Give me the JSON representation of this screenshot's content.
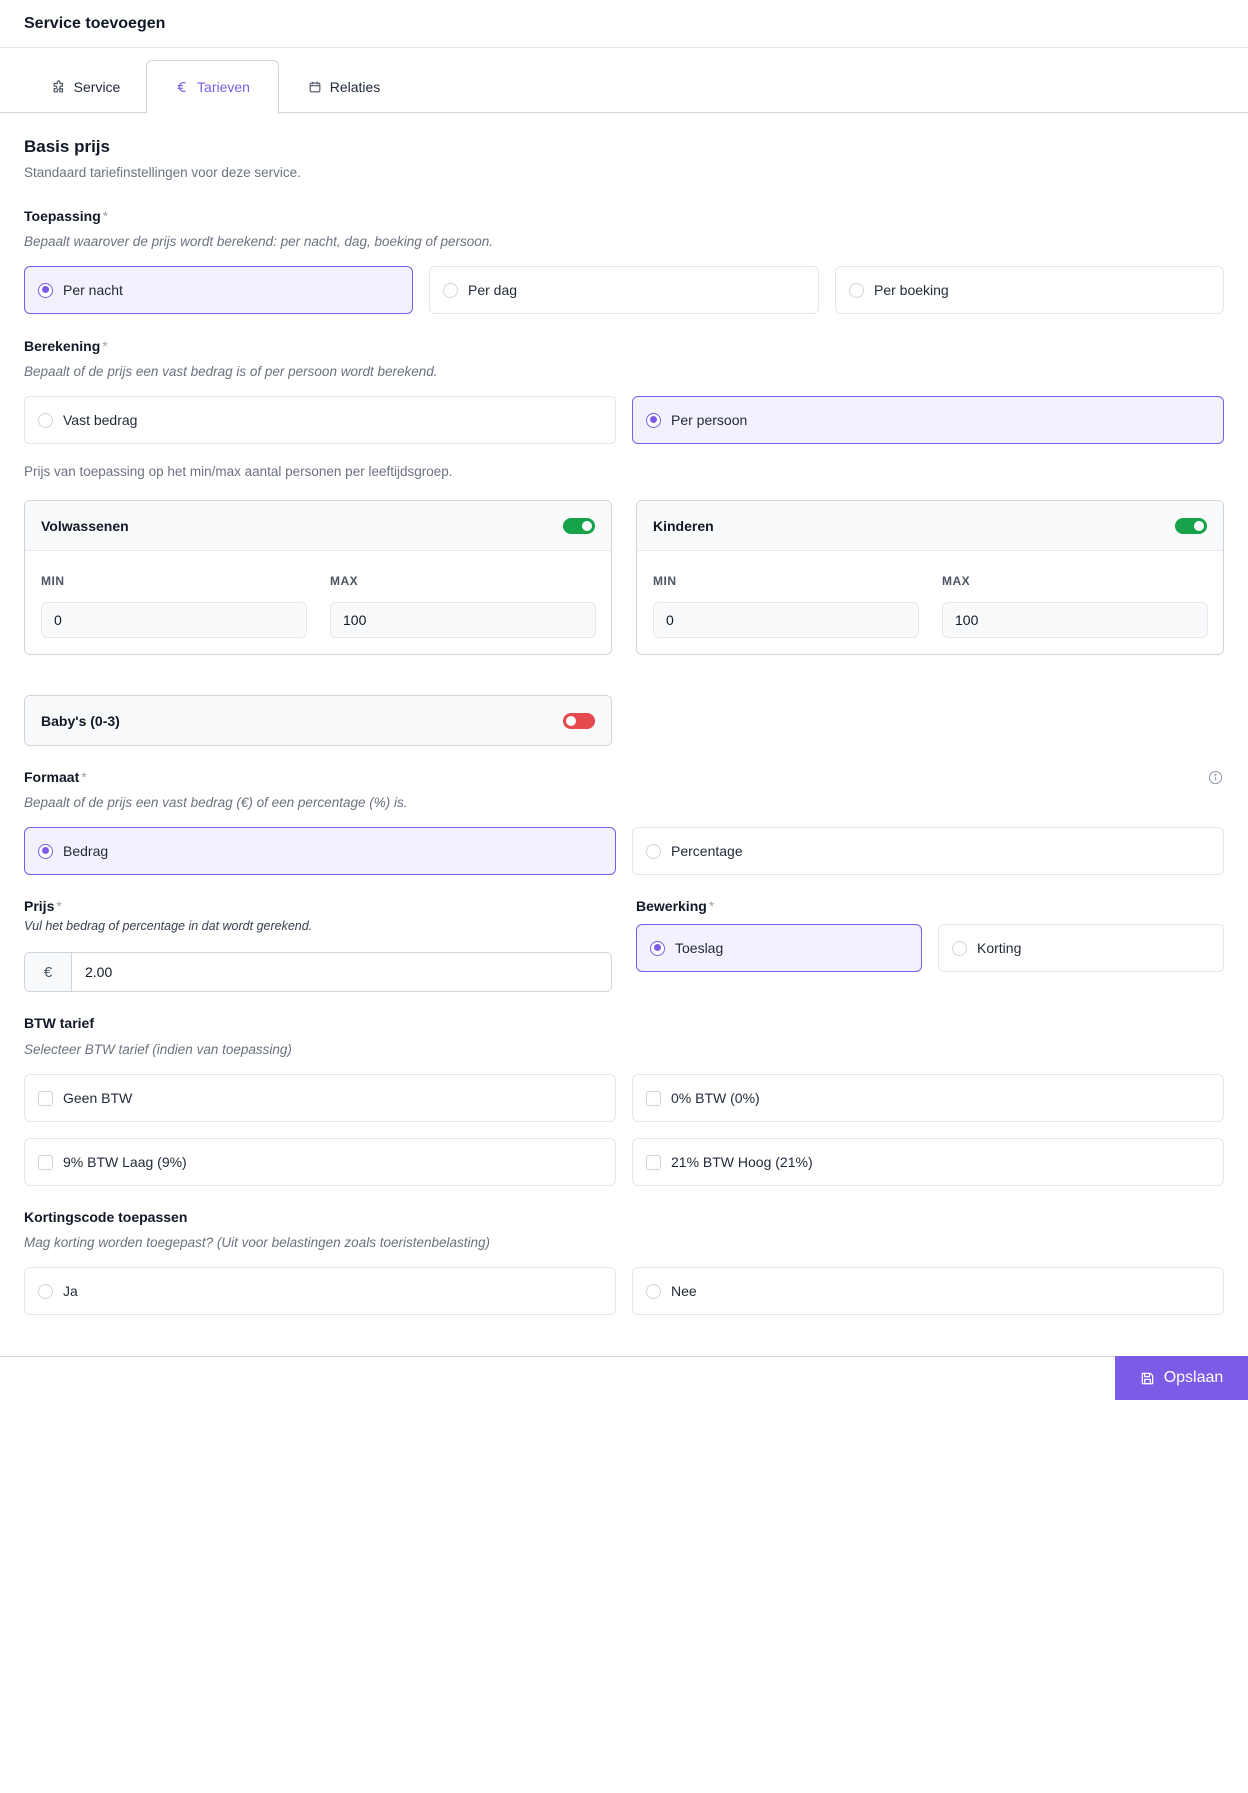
{
  "header": {
    "title": "Service toevoegen"
  },
  "tabs": [
    {
      "label": "Service",
      "icon": "puzzle-icon",
      "active": false
    },
    {
      "label": "Tarieven",
      "icon": "euro-icon",
      "active": true
    },
    {
      "label": "Relaties",
      "icon": "calendar-icon",
      "active": false
    }
  ],
  "section": {
    "title": "Basis prijs",
    "subtitle": "Standaard tariefinstellingen voor deze service."
  },
  "toepassing": {
    "label": "Toepassing",
    "required": "*",
    "help": "Bepaalt waarover de prijs wordt berekend: per nacht, dag, boeking of persoon.",
    "options": [
      "Per nacht",
      "Per dag",
      "Per boeking"
    ],
    "selected": "Per nacht"
  },
  "berekening": {
    "label": "Berekening",
    "required": "*",
    "help": "Bepaalt of de prijs een vast bedrag is of per persoon wordt berekend.",
    "options": [
      "Vast bedrag",
      "Per persoon"
    ],
    "selected": "Per persoon"
  },
  "persons_note": "Prijs van toepassing op het min/max aantal personen per leeftijdsgroep.",
  "groups": [
    {
      "title": "Volwassenen",
      "enabled": true,
      "min_label": "MIN",
      "max_label": "MAX",
      "min": "0",
      "max": "100"
    },
    {
      "title": "Kinderen",
      "enabled": true,
      "min_label": "MIN",
      "max_label": "MAX",
      "min": "0",
      "max": "100"
    },
    {
      "title": "Baby's (0-3)",
      "enabled": false
    }
  ],
  "formaat": {
    "label": "Formaat",
    "required": "*",
    "help": "Bepaalt of de prijs een vast bedrag (€) of een percentage (%) is.",
    "options": [
      "Bedrag",
      "Percentage"
    ],
    "selected": "Bedrag"
  },
  "prijs": {
    "label": "Prijs",
    "required": "*",
    "help": "Vul het bedrag of percentage in dat wordt gerekend.",
    "prefix": "€",
    "value": "2.00"
  },
  "bewerking": {
    "label": "Bewerking",
    "required": "*",
    "options": [
      "Toeslag",
      "Korting"
    ],
    "selected": "Toeslag"
  },
  "btw": {
    "label": "BTW tarief",
    "help": "Selecteer BTW tarief (indien van toepassing)",
    "options": [
      "Geen BTW",
      "0% BTW (0%)",
      "9% BTW Laag (9%)",
      "21% BTW Hoog (21%)"
    ]
  },
  "korting": {
    "label": "Kortingscode toepassen",
    "help": "Mag korting worden toegepast? (Uit voor belastingen zoals toeristenbelasting)",
    "options": [
      "Ja",
      "Nee"
    ]
  },
  "footer": {
    "save_label": "Opslaan"
  },
  "colors": {
    "accent": "#7c5ce6",
    "selected_bg": "#f3f1fd",
    "toggle_on": "#16a34a",
    "toggle_off": "#e5484d"
  }
}
